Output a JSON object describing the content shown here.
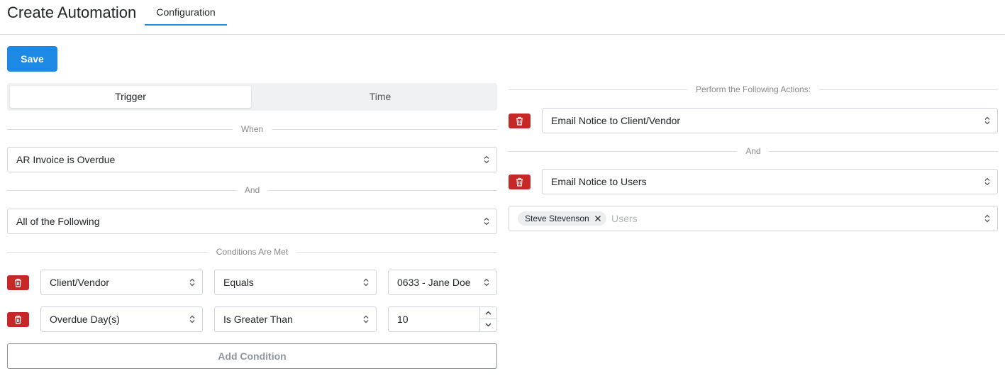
{
  "header": {
    "title": "Create Automation",
    "tabs": [
      {
        "label": "Configuration",
        "active": true
      }
    ]
  },
  "toolbar": {
    "save_label": "Save"
  },
  "mode_toggle": {
    "options": [
      "Trigger",
      "Time"
    ],
    "selected": "Trigger"
  },
  "left": {
    "when_label": "When",
    "when_value": "AR Invoice is Overdue",
    "and_label": "And",
    "match_value": "All of the Following",
    "conditions_label": "Conditions Are Met",
    "conditions": [
      {
        "field": "Client/Vendor",
        "operator": "Equals",
        "value": "0633 - Jane Doe"
      },
      {
        "field": "Overdue Day(s)",
        "operator": "Is Greater Than",
        "value": "10"
      }
    ],
    "add_condition_label": "Add Condition"
  },
  "right": {
    "actions_label": "Perform the Following Actions:",
    "actions": [
      {
        "value": "Email Notice to Client/Vendor"
      },
      {
        "value": "Email Notice to Users"
      }
    ],
    "and_label": "And",
    "users": {
      "selected": [
        "Steve Stevenson"
      ],
      "placeholder": "Users"
    }
  },
  "colors": {
    "primary": "#1e88e5",
    "danger": "#c62828"
  },
  "icons": {
    "delete": "trash-icon",
    "select": "chevron-up-down-icon",
    "remove": "close-icon"
  }
}
